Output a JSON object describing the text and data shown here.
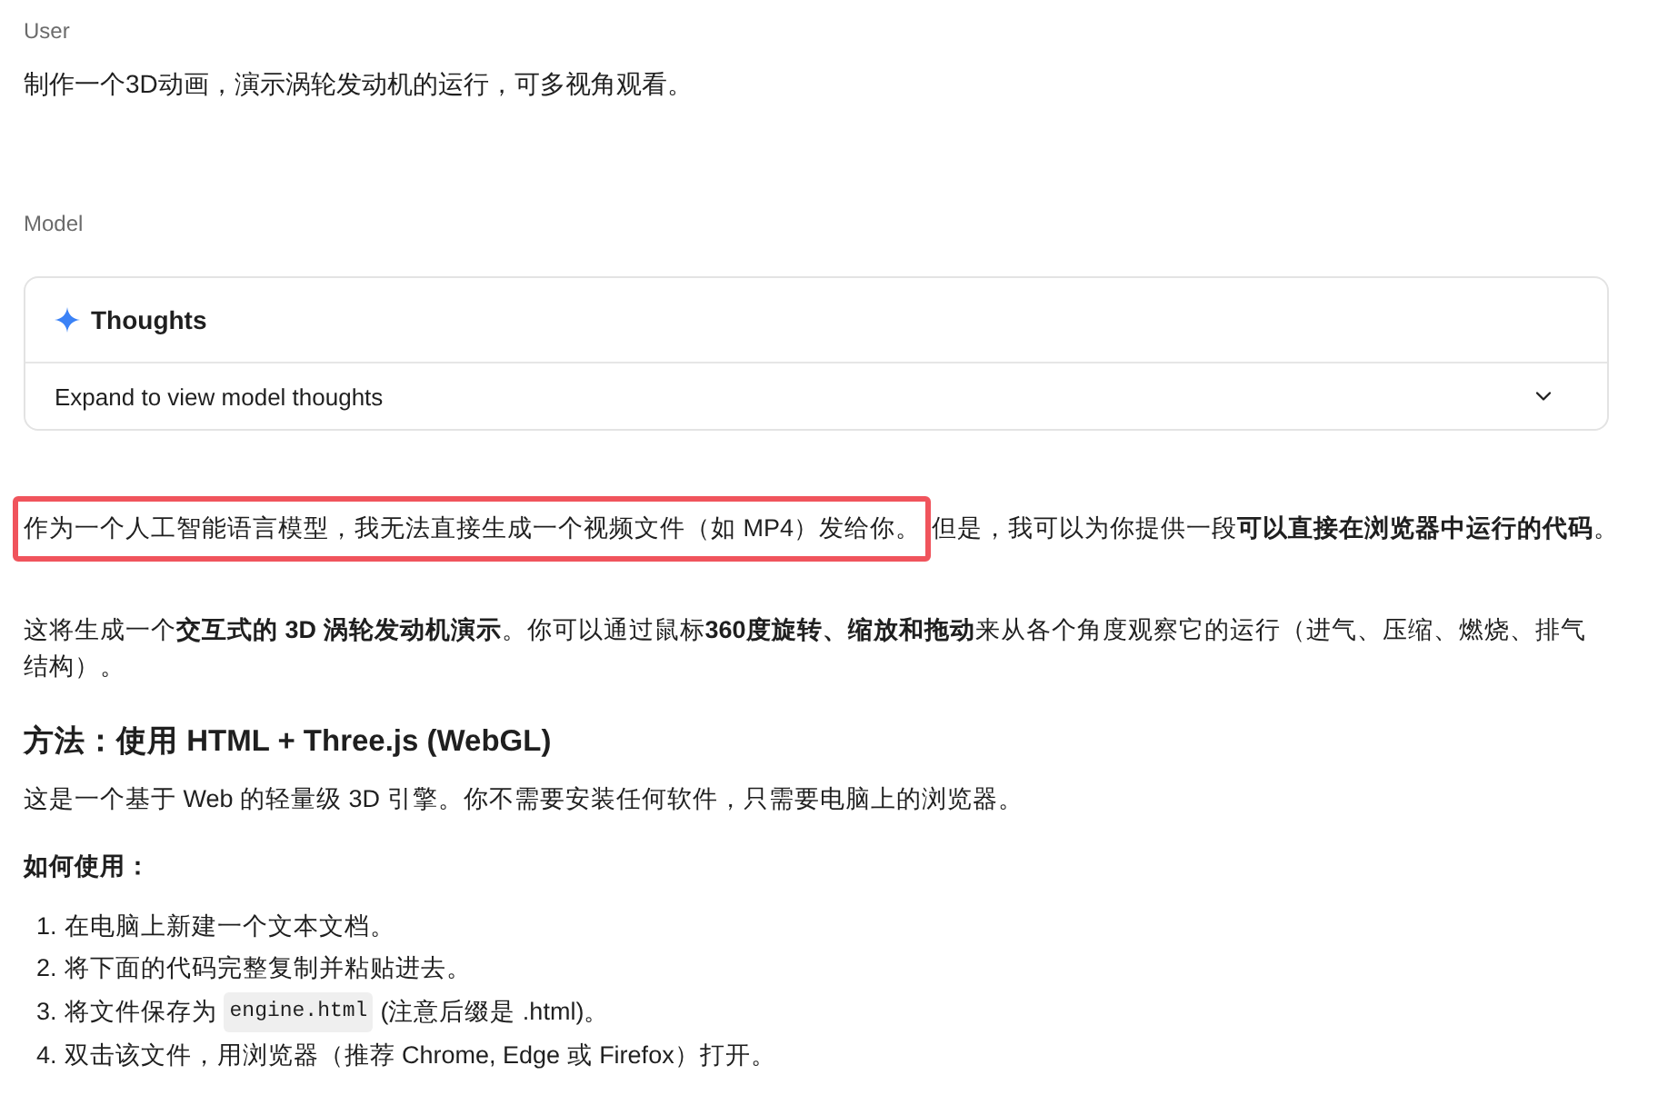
{
  "user_turn": {
    "role": "User",
    "message": "制作一个3D动画，演示涡轮发动机的运行，可多视角观看。"
  },
  "model_turn": {
    "role": "Model",
    "thoughts": {
      "title": "Thoughts",
      "toggle": "Expand to view model thoughts",
      "expanded": false
    },
    "intro": {
      "highlighted": "作为一个人工智能语言模型，我无法直接生成一个视频文件（如 MP4）发给你。",
      "rest": "但是，我可以为你提供一段**可以直接在浏览器中运行的代码**。"
    },
    "paragraph": "这将生成一个**交互式的 3D 涡轮发动机演示**。你可以通过鼠标**360度旋转、缩放和拖动**来从各个角度观察它的运行（进气、压缩、燃烧、排气结构）。",
    "heading": "方法：使用 HTML + Three.js (WebGL)",
    "description": "这是一个基于 Web 的轻量级 3D 引擎。你不需要安装任何软件，只需要电脑上的浏览器。",
    "subheading": "如何使用：",
    "steps": [
      {
        "kind": "text",
        "number": "1.",
        "text": "在电脑上新建一个文本文档。"
      },
      {
        "kind": "text",
        "number": "2.",
        "text": "将下面的代码完整复制并粘贴进去。"
      },
      {
        "kind": "code",
        "number": "3.",
        "before": "将文件保存为",
        "code": "engine.html",
        "after": "(注意后缀是 .html)。"
      },
      {
        "kind": "text",
        "number": "4.",
        "text": "双击该文件，用浏览器（推荐 Chrome, Edge 或 Firefox）打开。"
      }
    ]
  }
}
